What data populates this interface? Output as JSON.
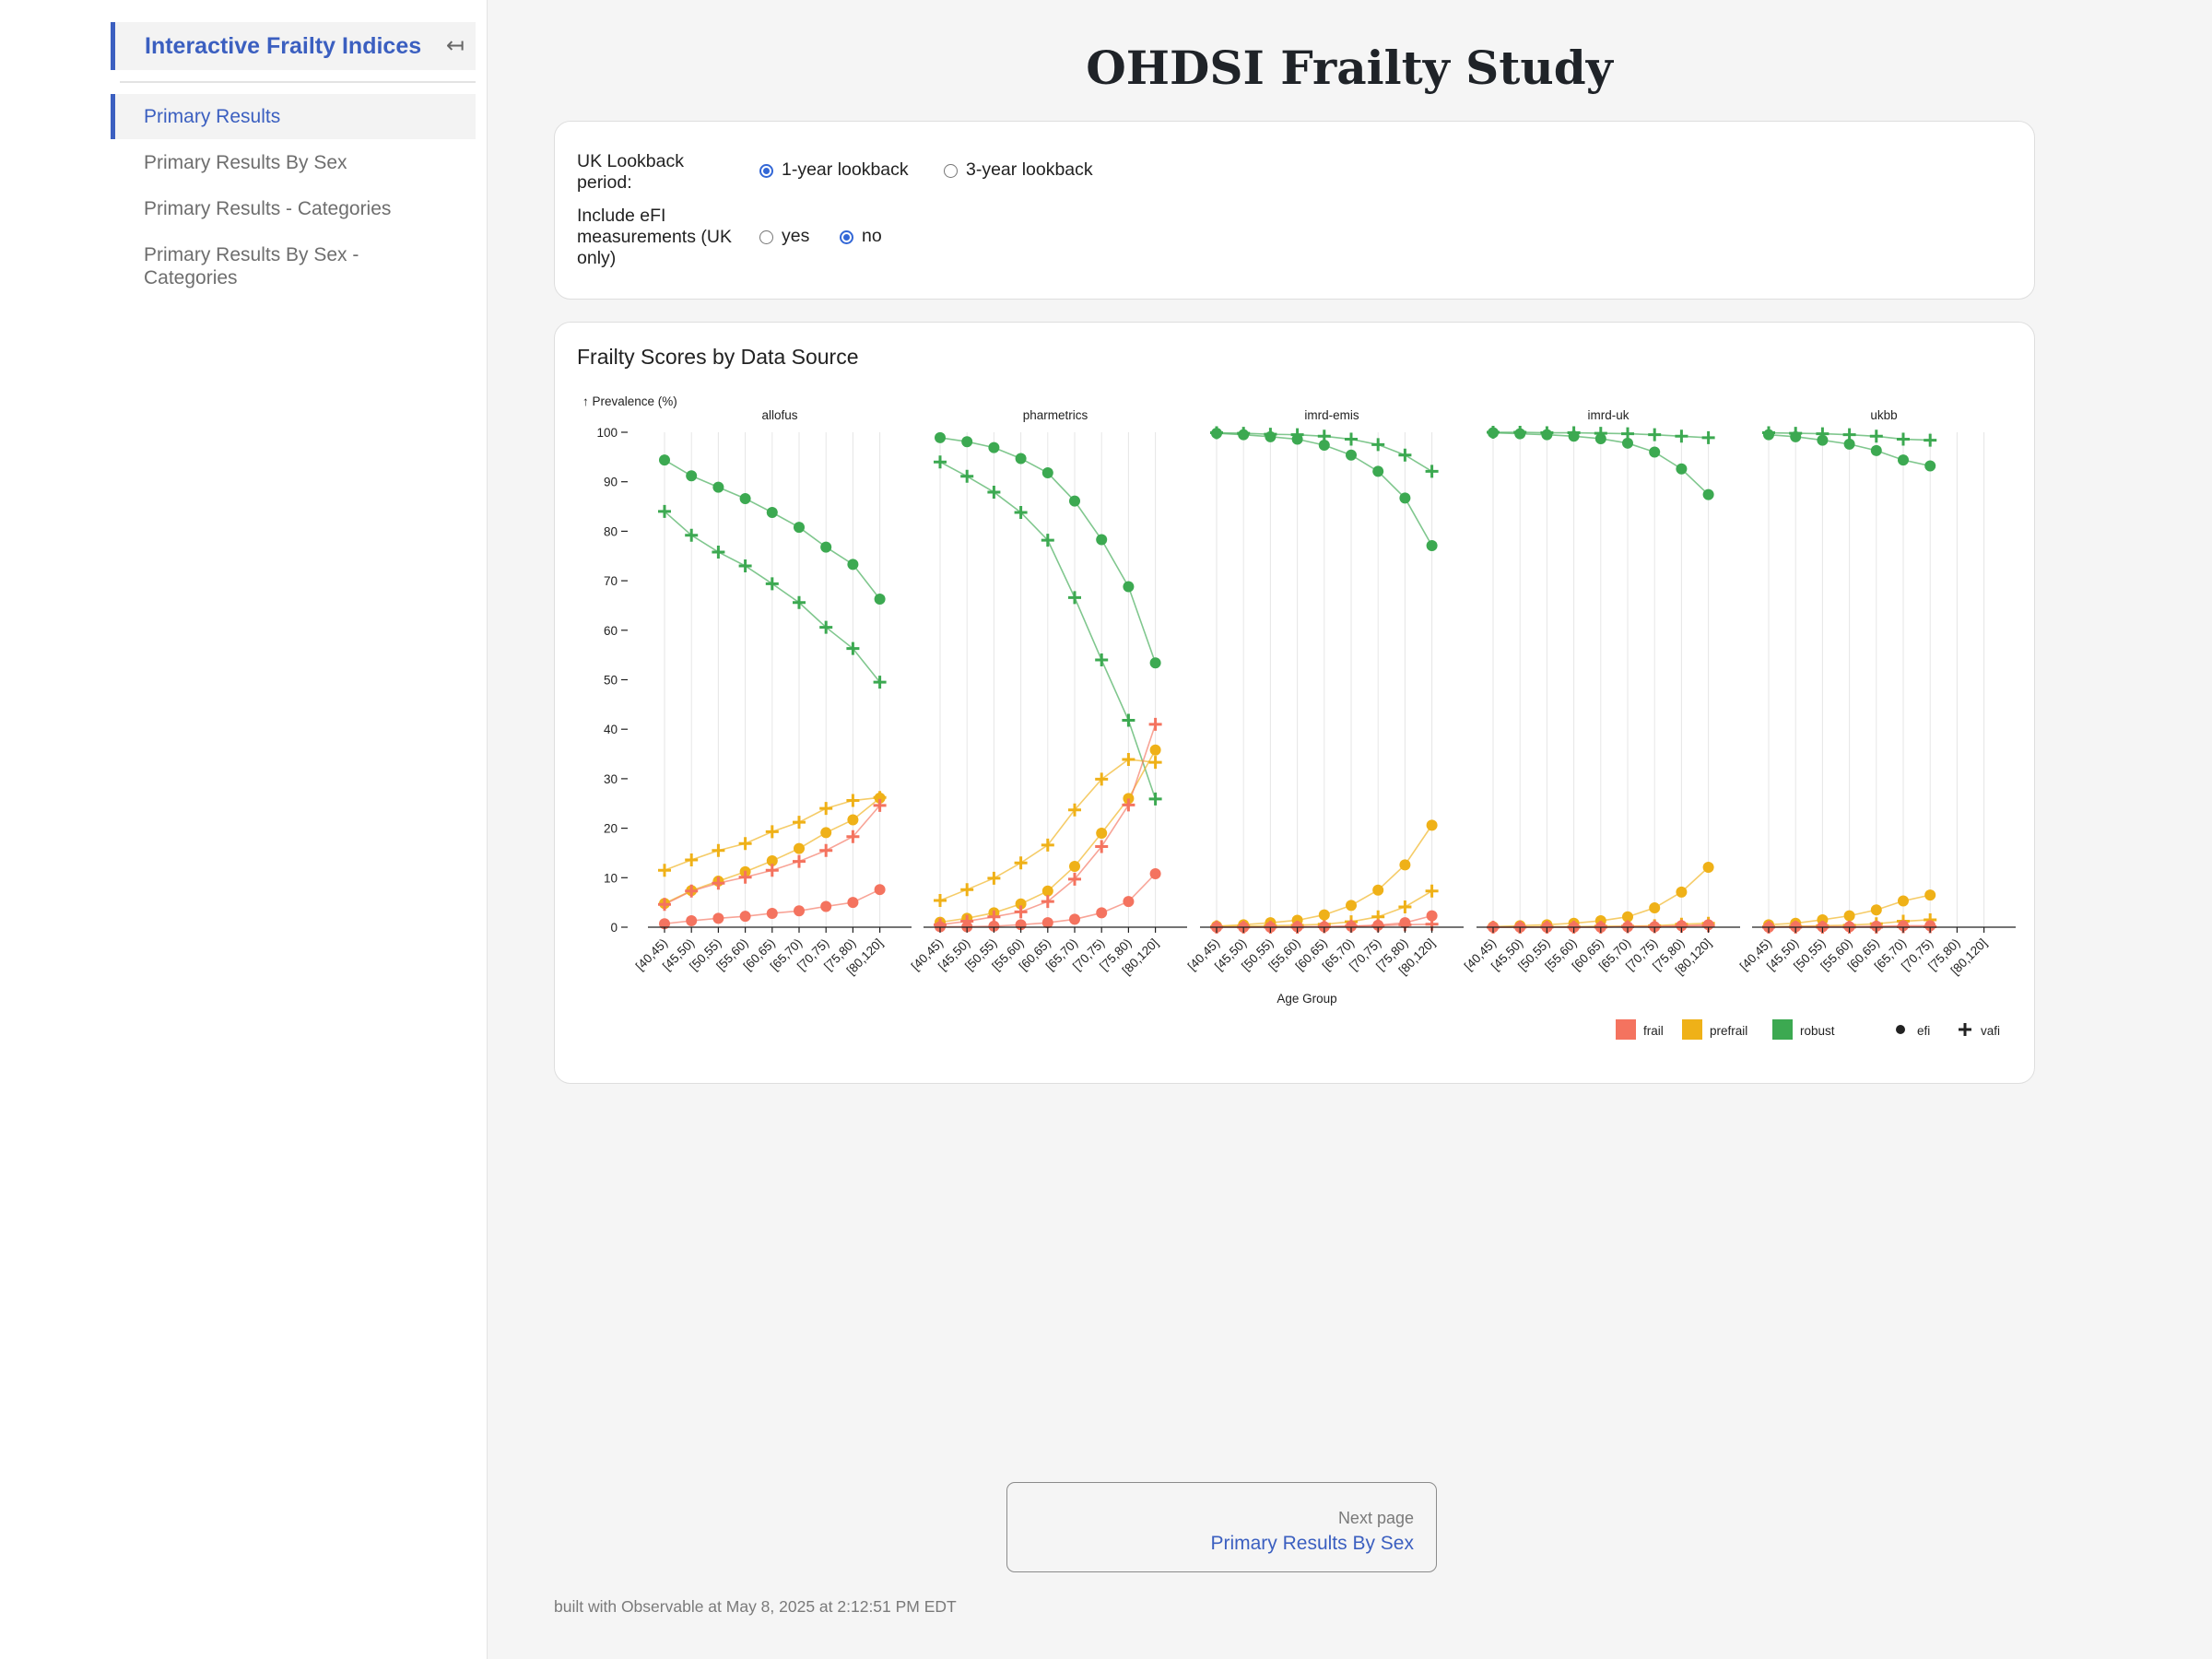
{
  "sidebar": {
    "title": "Interactive Frailty Indices",
    "collapse_icon": "↤",
    "items": [
      {
        "label": "Primary Results",
        "active": true
      },
      {
        "label": "Primary Results By Sex",
        "active": false
      },
      {
        "label": "Primary Results - Categories",
        "active": false
      },
      {
        "label": "Primary Results By Sex - Categories",
        "active": false
      }
    ]
  },
  "header": {
    "title": "OHDSI Frailty Study"
  },
  "controls": {
    "lookback": {
      "label": "UK Lookback period:",
      "options": [
        "1-year lookback",
        "3-year lookback"
      ],
      "selected": "1-year lookback"
    },
    "efi": {
      "label": "Include eFI measurements (UK only)",
      "options": [
        "yes",
        "no"
      ],
      "selected": "no"
    }
  },
  "chart_title": "Frailty Scores by Data Source",
  "chart_data": {
    "type": "line",
    "title": "Frailty Scores by Data Source",
    "ylabel": "↑ Prevalence (%)",
    "xlabel": "Age Group",
    "ylim": [
      0,
      100
    ],
    "yticks": [
      0,
      10,
      20,
      30,
      40,
      50,
      60,
      70,
      80,
      90,
      100
    ],
    "grid": "vertical",
    "legend_position": "bottom-right",
    "categories": [
      "[40,45)",
      "[45,50)",
      "[50,55)",
      "[55,60)",
      "[60,65)",
      "[65,70)",
      "[70,75)",
      "[75,80)",
      "[80,120]"
    ],
    "colors": {
      "frail": "#f4735f",
      "prefrail": "#efb118",
      "robust": "#3ca951"
    },
    "legend": {
      "color": [
        "frail",
        "prefrail",
        "robust"
      ],
      "symbol": [
        "efi",
        "vafi"
      ]
    },
    "panels": [
      {
        "name": "allofus",
        "series": [
          {
            "name": "efi robust",
            "status": "robust",
            "symbol": "efi",
            "values": [
              94.4,
              91.2,
              88.9,
              86.6,
              83.8,
              80.8,
              76.8,
              73.3,
              66.3
            ]
          },
          {
            "name": "vafi robust",
            "status": "robust",
            "symbol": "vafi",
            "values": [
              84,
              79.2,
              75.8,
              73,
              69.4,
              65.6,
              60.6,
              56.3,
              49.5
            ]
          },
          {
            "name": "efi prefrail",
            "status": "prefrail",
            "symbol": "efi",
            "values": [
              4.8,
              7.4,
              9.3,
              11.2,
              13.4,
              15.9,
              19.1,
              21.7,
              26.1
            ]
          },
          {
            "name": "vafi prefrail",
            "status": "prefrail",
            "symbol": "vafi",
            "values": [
              11.5,
              13.6,
              15.5,
              16.9,
              19.3,
              21.2,
              24,
              25.6,
              26.2
            ]
          },
          {
            "name": "vafi frail",
            "status": "frail",
            "symbol": "vafi",
            "values": [
              4.6,
              7.3,
              8.9,
              10.1,
              11.5,
              13.3,
              15.5,
              18.3,
              24.6
            ]
          },
          {
            "name": "efi frail",
            "status": "frail",
            "symbol": "efi",
            "values": [
              0.7,
              1.3,
              1.8,
              2.2,
              2.8,
              3.3,
              4.2,
              5,
              7.6
            ]
          }
        ]
      },
      {
        "name": "pharmetrics",
        "series": [
          {
            "name": "efi robust",
            "status": "robust",
            "symbol": "efi",
            "values": [
              98.9,
              98.1,
              96.9,
              94.7,
              91.8,
              86.1,
              78.3,
              68.8,
              53.4
            ]
          },
          {
            "name": "vafi robust",
            "status": "robust",
            "symbol": "vafi",
            "values": [
              94,
              91.1,
              87.9,
              83.8,
              78.2,
              66.6,
              54,
              41.8,
              25.9
            ]
          },
          {
            "name": "efi prefrail",
            "status": "prefrail",
            "symbol": "efi",
            "values": [
              1,
              1.8,
              2.9,
              4.7,
              7.3,
              12.3,
              19,
              26,
              35.8
            ]
          },
          {
            "name": "vafi prefrail",
            "status": "prefrail",
            "symbol": "vafi",
            "values": [
              5.4,
              7.6,
              9.9,
              13,
              16.6,
              23.7,
              29.9,
              33.9,
              33.3
            ]
          },
          {
            "name": "vafi frail",
            "status": "frail",
            "symbol": "vafi",
            "values": [
              0.5,
              1.2,
              2.1,
              3.1,
              5.2,
              9.7,
              16.3,
              24.7,
              41
            ]
          },
          {
            "name": "efi frail",
            "status": "frail",
            "symbol": "efi",
            "values": [
              0.1,
              0.1,
              0.2,
              0.5,
              0.9,
              1.6,
              2.9,
              5.2,
              10.8
            ]
          }
        ]
      },
      {
        "name": "imrd-emis",
        "series": [
          {
            "name": "efi robust",
            "status": "robust",
            "symbol": "efi",
            "values": [
              99.8,
              99.5,
              99.1,
              98.6,
              97.4,
              95.4,
              92.1,
              86.7,
              77.1
            ]
          },
          {
            "name": "vafi robust",
            "status": "robust",
            "symbol": "vafi",
            "values": [
              99.9,
              99.8,
              99.6,
              99.5,
              99.2,
              98.6,
              97.5,
              95.4,
              92.1
            ]
          },
          {
            "name": "efi prefrail",
            "status": "prefrail",
            "symbol": "efi",
            "values": [
              0.2,
              0.5,
              0.9,
              1.4,
              2.5,
              4.4,
              7.5,
              12.6,
              20.6
            ]
          },
          {
            "name": "vafi prefrail",
            "status": "prefrail",
            "symbol": "vafi",
            "values": [
              0.1,
              0.2,
              0.3,
              0.4,
              0.6,
              1.1,
              2.1,
              4.1,
              7.3
            ]
          },
          {
            "name": "efi frail",
            "status": "frail",
            "symbol": "efi",
            "values": [
              0,
              0,
              0,
              0.1,
              0.1,
              0.2,
              0.4,
              0.9,
              2.3
            ]
          },
          {
            "name": "vafi frail",
            "status": "frail",
            "symbol": "vafi",
            "values": [
              0,
              0,
              0,
              0,
              0.1,
              0.2,
              0.3,
              0.5,
              0.6
            ]
          }
        ]
      },
      {
        "name": "imrd-uk",
        "series": [
          {
            "name": "efi robust",
            "status": "robust",
            "symbol": "efi",
            "values": [
              99.9,
              99.7,
              99.5,
              99.2,
              98.7,
              97.8,
              96,
              92.6,
              87.4
            ]
          },
          {
            "name": "vafi robust",
            "status": "robust",
            "symbol": "vafi",
            "values": [
              100,
              100,
              99.9,
              99.9,
              99.8,
              99.7,
              99.5,
              99.2,
              98.9
            ]
          },
          {
            "name": "efi prefrail",
            "status": "prefrail",
            "symbol": "efi",
            "values": [
              0.1,
              0.3,
              0.5,
              0.8,
              1.3,
              2.1,
              3.9,
              7.1,
              12.1
            ]
          },
          {
            "name": "vafi prefrail",
            "status": "prefrail",
            "symbol": "vafi",
            "values": [
              0,
              0,
              0.1,
              0.1,
              0.2,
              0.2,
              0.3,
              0.6,
              0.8
            ]
          },
          {
            "name": "efi frail",
            "status": "frail",
            "symbol": "efi",
            "values": [
              0,
              0,
              0,
              0,
              0,
              0.1,
              0.1,
              0.3,
              0.5
            ]
          },
          {
            "name": "vafi frail",
            "status": "frail",
            "symbol": "vafi",
            "values": [
              0,
              0,
              0,
              0,
              0,
              0.1,
              0.1,
              0.2,
              0.3
            ]
          }
        ]
      },
      {
        "name": "ukbb",
        "series": [
          {
            "name": "efi robust",
            "status": "robust",
            "symbol": "efi",
            "values": [
              99.5,
              99.1,
              98.4,
              97.6,
              96.3,
              94.4,
              93.2
            ]
          },
          {
            "name": "vafi robust",
            "status": "robust",
            "symbol": "vafi",
            "values": [
              99.9,
              99.8,
              99.7,
              99.5,
              99.2,
              98.6,
              98.4
            ]
          },
          {
            "name": "efi prefrail",
            "status": "prefrail",
            "symbol": "efi",
            "values": [
              0.5,
              0.8,
              1.5,
              2.3,
              3.5,
              5.3,
              6.5
            ]
          },
          {
            "name": "vafi prefrail",
            "status": "prefrail",
            "symbol": "vafi",
            "values": [
              0.1,
              0.2,
              0.3,
              0.4,
              0.7,
              1.2,
              1.5
            ]
          },
          {
            "name": "efi frail",
            "status": "frail",
            "symbol": "efi",
            "values": [
              0,
              0.1,
              0.1,
              0.1,
              0.2,
              0.3,
              0.3
            ]
          },
          {
            "name": "vafi frail",
            "status": "frail",
            "symbol": "vafi",
            "values": [
              0,
              0,
              0,
              0,
              0,
              0.1,
              0.1
            ]
          }
        ]
      }
    ]
  },
  "next_page": {
    "label": "Next page",
    "title": "Primary Results By Sex"
  },
  "footer": "built with Observable at May 8, 2025 at 2:12:51 PM EDT"
}
